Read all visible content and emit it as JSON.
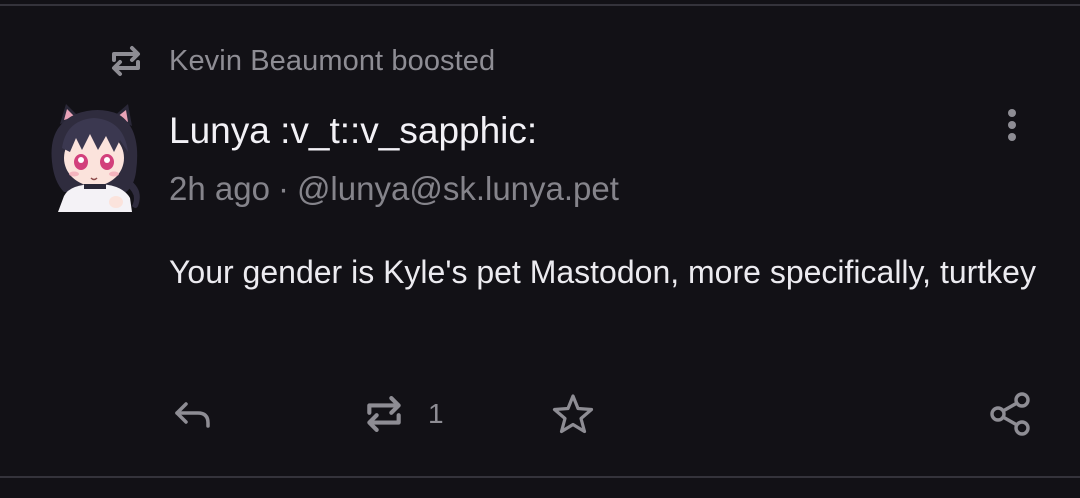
{
  "boost": {
    "text": "Kevin Beaumont boosted",
    "icon": "boost-icon"
  },
  "post": {
    "display_name": "Lunya :v_t::v_sapphic:",
    "time": "2h ago",
    "separator": "·",
    "handle": "@lunya@sk.lunya.pet",
    "content": "Your gender is Kyle's pet Mastodon, more specifically, turtkey",
    "avatar_icon": "anime-cat-girl-avatar"
  },
  "actions": {
    "reply_icon": "reply-icon",
    "boost_icon": "boost-icon",
    "boost_count": "1",
    "favorite_icon": "star-icon",
    "share_icon": "share-icon",
    "more_icon": "more-vertical-icon"
  },
  "colors": {
    "background": "#121116",
    "primary_text": "#f2f1f6",
    "secondary_text": "#85848b",
    "divider": "#34333b"
  }
}
